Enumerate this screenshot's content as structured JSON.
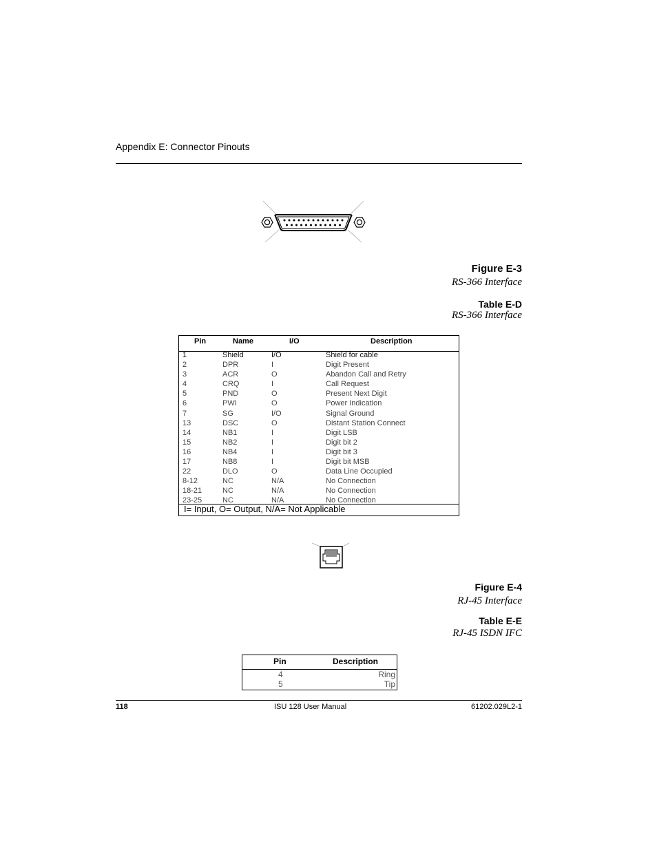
{
  "header": {
    "title": "Appendix E: Connector Pinouts"
  },
  "figure_e3": {
    "icon": "db25-connector-icon",
    "title": "Figure E-3",
    "subtitle": "RS-366 Interface"
  },
  "table_ed": {
    "title": "Table E-D",
    "subtitle": "RS-366 Interface",
    "columns": [
      "Pin",
      "Name",
      "I/O",
      "Description"
    ],
    "rows": [
      [
        "1",
        "Shield",
        "I/O",
        "Shield for cable"
      ],
      [
        "2",
        "DPR",
        "I",
        "Digit Present"
      ],
      [
        "3",
        "ACR",
        "O",
        "Abandon Call and Retry"
      ],
      [
        "4",
        "CRQ",
        "I",
        "Call Request"
      ],
      [
        "5",
        "PND",
        "O",
        "Present Next Digit"
      ],
      [
        "6",
        "PWI",
        "O",
        "Power Indication"
      ],
      [
        "7",
        "SG",
        "I/O",
        "Signal Ground"
      ],
      [
        "13",
        "DSC",
        "O",
        "Distant Station Connect"
      ],
      [
        "14",
        "NB1",
        "I",
        "Digit LSB"
      ],
      [
        "15",
        "NB2",
        "I",
        "Digit bit 2"
      ],
      [
        "16",
        "NB4",
        "I",
        "Digit bit 3"
      ],
      [
        "17",
        "NB8",
        "I",
        "Digit bit MSB"
      ],
      [
        "22",
        "DLO",
        "O",
        "Data Line Occupied"
      ],
      [
        "8-12",
        "NC",
        "N/A",
        "No Connection"
      ],
      [
        "18-21",
        "NC",
        "N/A",
        "No Connection"
      ],
      [
        "23-25",
        "NC",
        "N/A",
        "No Connection"
      ]
    ],
    "footnote": "I= Input, O= Output, N/A= Not Applicable"
  },
  "figure_e4": {
    "icon": "rj45-connector-icon",
    "title": "Figure E-4",
    "subtitle": "RJ-45 Interface"
  },
  "table_ee": {
    "title": "Table E-E",
    "subtitle": "RJ-45 ISDN IFC",
    "columns": [
      "Pin",
      "Description"
    ],
    "rows": [
      [
        "4",
        "Ring"
      ],
      [
        "5",
        "Tip"
      ]
    ]
  },
  "footer": {
    "page_number": "118",
    "manual_title": "ISU 128 User Manual",
    "doc_number": "61202.029L2-1"
  }
}
